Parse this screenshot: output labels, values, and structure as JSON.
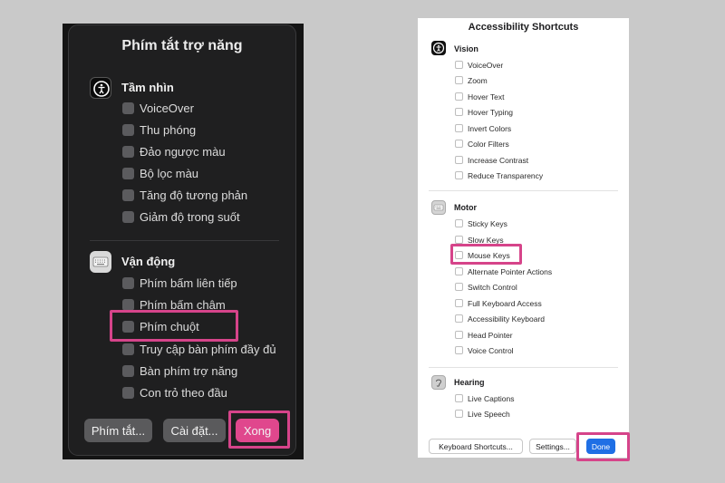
{
  "colors": {
    "highlight": "#d6448a",
    "dark_primary": "#e0478d",
    "light_primary": "#1f6fe5"
  },
  "dark_panel": {
    "title": "Phím tắt trợ năng",
    "sections": [
      {
        "label": "Tầm nhìn",
        "icon": "accessibility-icon",
        "items": [
          "VoiceOver",
          "Thu phóng",
          "Đảo ngược màu",
          "Bộ lọc màu",
          "Tăng độ tương phản",
          "Giảm độ trong suốt"
        ]
      },
      {
        "label": "Vận động",
        "icon": "keyboard-icon",
        "items": [
          "Phím bấm liên tiếp",
          "Phím bấm chậm",
          "Phím chuột",
          "Truy cập bàn phím đầy đủ",
          "Bàn phím trợ năng",
          "Con trỏ theo đầu"
        ]
      }
    ],
    "buttons": {
      "shortcuts": "Phím tắt...",
      "settings": "Cài đặt...",
      "done": "Xong"
    }
  },
  "light_panel": {
    "title": "Accessibility Shortcuts",
    "sections": [
      {
        "label": "Vision",
        "icon": "accessibility-icon",
        "items": [
          "VoiceOver",
          "Zoom",
          "Hover Text",
          "Hover Typing",
          "Invert Colors",
          "Color Filters",
          "Increase Contrast",
          "Reduce Transparency"
        ]
      },
      {
        "label": "Motor",
        "icon": "keyboard-icon",
        "items": [
          "Sticky Keys",
          "Slow Keys",
          "Mouse Keys",
          "Alternate Pointer Actions",
          "Switch Control",
          "Full Keyboard Access",
          "Accessibility Keyboard",
          "Head Pointer",
          "Voice Control"
        ]
      },
      {
        "label": "Hearing",
        "icon": "ear-icon",
        "items": [
          "Live Captions",
          "Live Speech"
        ]
      }
    ],
    "buttons": {
      "shortcuts": "Keyboard Shortcuts...",
      "settings": "Settings...",
      "done": "Done"
    }
  }
}
